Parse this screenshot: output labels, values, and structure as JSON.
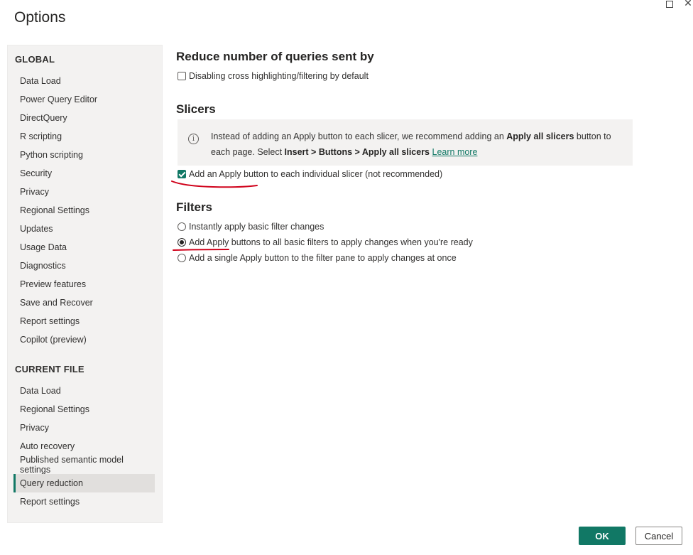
{
  "dialog": {
    "title": "Options"
  },
  "sidebar": {
    "global_header": "GLOBAL",
    "global_items": [
      "Data Load",
      "Power Query Editor",
      "DirectQuery",
      "R scripting",
      "Python scripting",
      "Security",
      "Privacy",
      "Regional Settings",
      "Updates",
      "Usage Data",
      "Diagnostics",
      "Preview features",
      "Save and Recover",
      "Report settings",
      "Copilot (preview)"
    ],
    "current_file_header": "CURRENT FILE",
    "current_file_items": [
      "Data Load",
      "Regional Settings",
      "Privacy",
      "Auto recovery",
      "Published semantic model settings",
      "Query reduction",
      "Report settings"
    ],
    "selected_item": "Query reduction"
  },
  "content": {
    "reduce_heading": "Reduce number of queries sent by",
    "disable_cross_highlight": {
      "label": "Disabling cross highlighting/filtering by default",
      "checked": false
    },
    "slicers_heading": "Slicers",
    "info": {
      "text_1": "Instead of adding an Apply button to each slicer, we recommend adding an ",
      "bold_1": "Apply all slicers",
      "text_2": " button to each page. Select ",
      "bold_2": "Insert > Buttons > Apply all slicers",
      "learn_more": "Learn more"
    },
    "slicer_apply_button": {
      "label": "Add an Apply button to each individual slicer (not recommended)",
      "checked": true
    },
    "filters_heading": "Filters",
    "filter_options": [
      {
        "label": "Instantly apply basic filter changes",
        "selected": false
      },
      {
        "label": "Add Apply buttons to all basic filters to apply changes when you're ready",
        "selected": true
      },
      {
        "label": "Add a single Apply button to the filter pane to apply changes at once",
        "selected": false
      }
    ]
  },
  "footer": {
    "ok_label": "OK",
    "cancel_label": "Cancel"
  },
  "colors": {
    "accent": "#117865",
    "annotation": "#d0021b",
    "sidebar_bg": "#f3f2f1"
  }
}
